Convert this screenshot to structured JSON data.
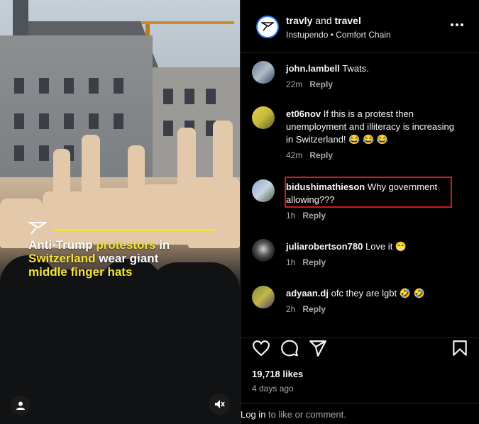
{
  "post": {
    "author": "travly",
    "connector": "and",
    "coauthor": "travel",
    "audio": "Instupendo • Comfort Chain",
    "caption_part1": "Anti-Trump ",
    "caption_part2": "protestors",
    "caption_part3": " in ",
    "caption_part4": "Switzerland",
    "caption_part5": "  wear giant ",
    "caption_part6": "middle finger hats",
    "accent_color": "#f5e23a"
  },
  "comments": [
    {
      "user": "john.lambell",
      "text": "Twats.",
      "time": "22m",
      "reply": "Reply"
    },
    {
      "user": "et06nov",
      "text": "If this is a protest then unemployment and illiteracy is increasing in Switzerland! 😂 😂 😂",
      "time": "42m",
      "reply": "Reply"
    },
    {
      "user": "bidushimathieson",
      "text": "Why government allowing???",
      "time": "1h",
      "reply": "Reply"
    },
    {
      "user": "juliarobertson780",
      "text": "Love it 😁",
      "time": "1h",
      "reply": "Reply"
    },
    {
      "user": "adyaan.dj",
      "text": "ofc they are lgbt 🤣 🤣",
      "time": "2h",
      "reply": "Reply"
    }
  ],
  "stats": {
    "likes": "19,718 likes",
    "date": "4 days ago"
  },
  "footer": {
    "login_link": "Log in",
    "login_rest": " to like or comment."
  },
  "icons": {
    "like": "heart-icon",
    "comment": "comment-icon",
    "share": "share-icon",
    "save": "bookmark-icon",
    "more": "more-icon",
    "mute": "mute-icon",
    "tag": "user-icon"
  },
  "highlight_color": "#d11a1a"
}
